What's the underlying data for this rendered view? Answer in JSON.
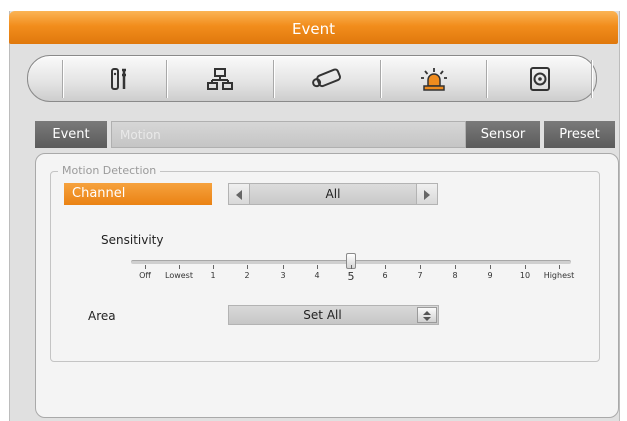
{
  "window": {
    "title": "Event"
  },
  "toolbar": {
    "buttons": [
      {
        "icon": "tools-icon"
      },
      {
        "icon": "network-icon"
      },
      {
        "icon": "camera-icon"
      },
      {
        "icon": "alarm-light-icon",
        "active": true
      },
      {
        "icon": "storage-disk-icon"
      }
    ]
  },
  "tabs": {
    "event": "Event",
    "current": "Motion",
    "sensor": "Sensor",
    "preset": "Preset"
  },
  "motion": {
    "group_title": "Motion Detection",
    "channel_label": "Channel",
    "channel_value": "All",
    "sensitivity_label": "Sensitivity",
    "sensitivity_labels": [
      "Off",
      "Lowest",
      "1",
      "2",
      "3",
      "4",
      "5",
      "6",
      "7",
      "8",
      "9",
      "10",
      "Highest"
    ],
    "sensitivity_value": "5",
    "area_label": "Area",
    "area_value": "Set All"
  },
  "colors": {
    "accent": "#ef8a1a",
    "tab_dark": "#666666"
  }
}
